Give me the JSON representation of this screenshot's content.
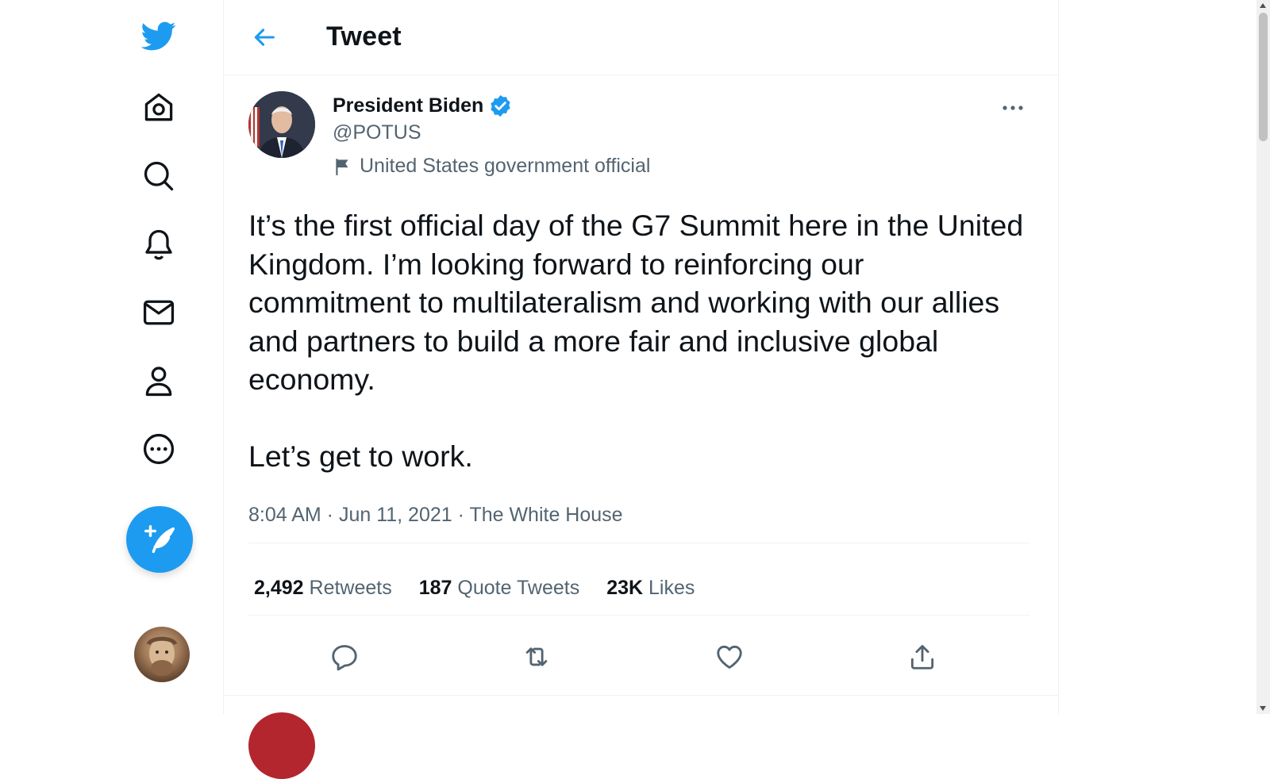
{
  "header": {
    "title": "Tweet"
  },
  "nav": {
    "items": [
      {
        "icon": "twitter-logo-icon"
      },
      {
        "icon": "home-icon"
      },
      {
        "icon": "explore-icon"
      },
      {
        "icon": "notifications-icon"
      },
      {
        "icon": "messages-icon"
      },
      {
        "icon": "profile-icon"
      },
      {
        "icon": "more-icon"
      }
    ],
    "compose_icon": "compose-tweet-icon"
  },
  "tweet": {
    "author_name": "President Biden",
    "handle": "@POTUS",
    "label": "United States government official",
    "text": "It’s the first official day of the G7 Summit here in the United Kingdom. I’m looking forward to reinforcing our commitment to multilateralism and working with our allies and partners to build a more fair and inclusive global economy.\n\nLet’s get to work.",
    "time": "8:04 AM",
    "date": "Jun 11, 2021",
    "source": "The White House",
    "separator": " · "
  },
  "stats": {
    "retweets_count": "2,492",
    "retweets_label": "Retweets",
    "quotes_count": "187",
    "quotes_label": "Quote Tweets",
    "likes_count": "23K",
    "likes_label": "Likes"
  },
  "actions": [
    "reply-icon",
    "retweet-icon",
    "like-icon",
    "share-icon"
  ],
  "colors": {
    "accent": "#1d9bf0",
    "text": "#0f1419",
    "muted": "#536471",
    "border": "#eff3f4"
  }
}
